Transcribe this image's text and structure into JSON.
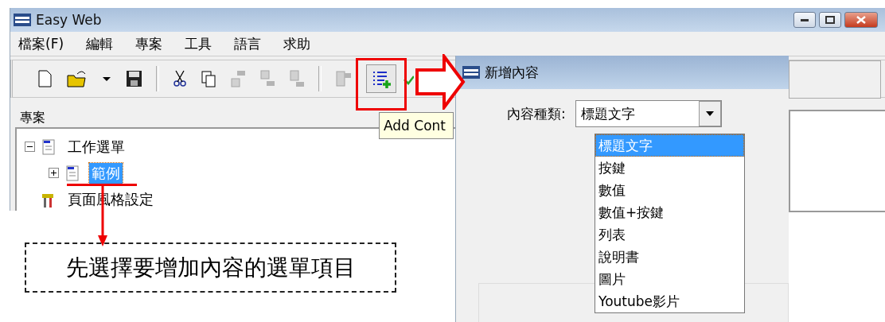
{
  "window": {
    "title": "Easy Web"
  },
  "menu": [
    "檔案(F)",
    "編輯",
    "專案",
    "工具",
    "語言",
    "求助"
  ],
  "project_panel": {
    "title": "專案",
    "tree": [
      {
        "label": "工作選單",
        "expanded": true,
        "selected": false,
        "children": [
          {
            "label": "範例",
            "expanded": false,
            "selected": true
          }
        ]
      },
      {
        "label": "頁面風格設定",
        "selected": false
      }
    ]
  },
  "tooltip": "Add Cont",
  "dialog": {
    "title": "新增內容",
    "field_label": "內容種類:",
    "value": "標題文字",
    "options": [
      {
        "label": "標題文字",
        "selected": true
      },
      {
        "label": "按鍵",
        "selected": false
      },
      {
        "label": "數值",
        "selected": false
      },
      {
        "label": "數值+按鍵",
        "selected": false
      },
      {
        "label": "列表",
        "selected": false
      },
      {
        "label": "說明書",
        "selected": false
      },
      {
        "label": "圖片",
        "selected": false
      },
      {
        "label": "Youtube影片",
        "selected": false
      }
    ]
  },
  "annotation": "先選擇要增加內容的選單項目"
}
